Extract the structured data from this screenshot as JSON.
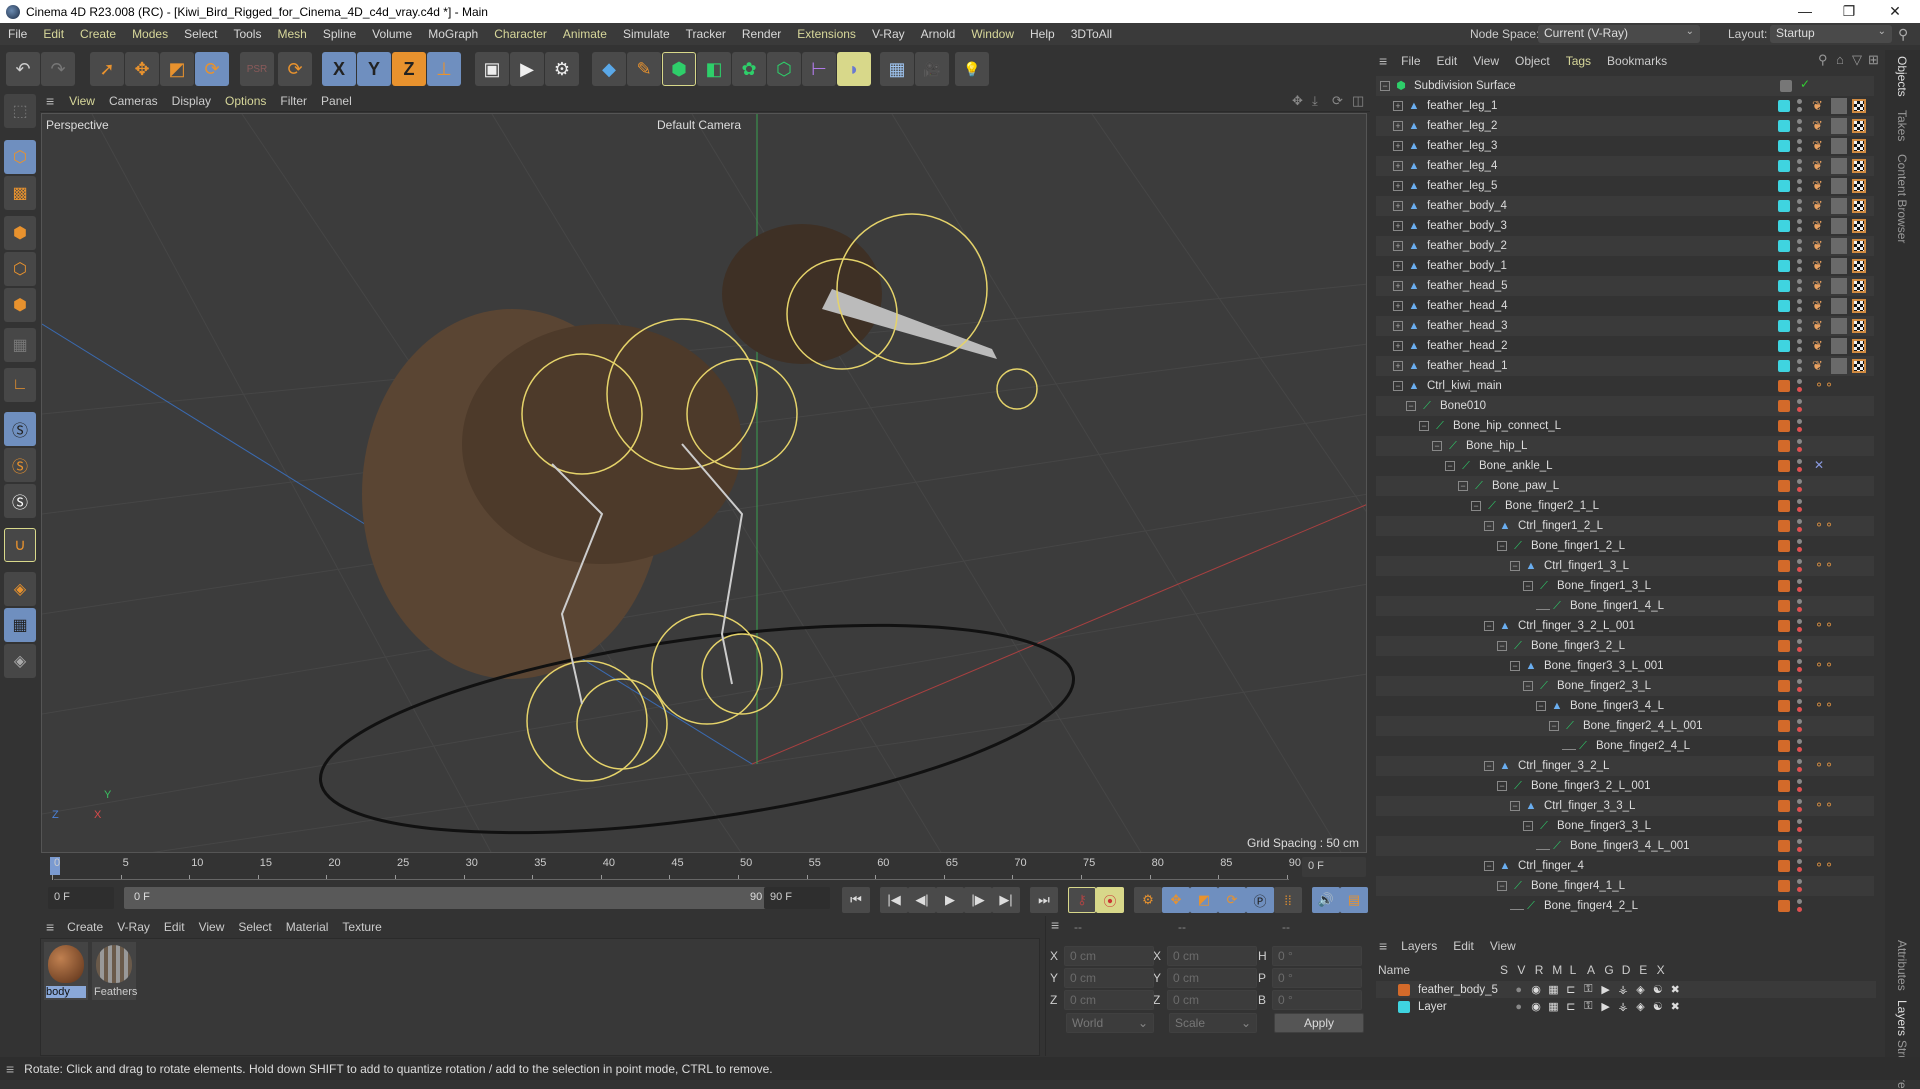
{
  "window": {
    "title": "Cinema 4D R23.008 (RC) - [Kiwi_Bird_Rigged_for_Cinema_4D_c4d_vray.c4d *] - Main",
    "minimize_icon": "—",
    "maximize_icon": "❐",
    "close_icon": "✕"
  },
  "menubar": {
    "items": [
      "File",
      "Edit",
      "Create",
      "Modes",
      "Select",
      "Tools",
      "Mesh",
      "Spline",
      "Volume",
      "MoGraph",
      "Character",
      "Animate",
      "Simulate",
      "Tracker",
      "Render",
      "Extensions",
      "V-Ray",
      "Arnold",
      "Window",
      "Help",
      "3DToAll"
    ],
    "node_space_label": "Node Space:",
    "node_space_value": "Current (V-Ray)",
    "layout_label": "Layout:",
    "layout_value": "Startup"
  },
  "toolbar": {
    "undo": "↶",
    "redo": "↷",
    "select": "➚",
    "move": "✥",
    "scale": "◩",
    "rotate": "⟳",
    "psr": "PSR",
    "recent": "⟳",
    "x_axis": "X",
    "y_axis": "Y",
    "z_axis": "Z",
    "coord_system": "⊥",
    "render_view": "▣",
    "render_pv": "▶",
    "render_settings": "⚙",
    "cube": "◆",
    "pen": "✎",
    "subdivision": "⬢",
    "extrude": "◧",
    "mograph_cloner": "✿",
    "array": "⬡",
    "deformer": "⊢",
    "field": "◗",
    "floor": "▦",
    "camera": "🎥",
    "light": "💡"
  },
  "left_tools": {
    "items": [
      "model-mode",
      "texture-mode",
      "points-mode",
      "edges-mode",
      "polygons-mode",
      "uv-mode",
      "axis-mode",
      "snap-s1",
      "snap-s2",
      "snap-s3",
      "magnet",
      "workplane",
      "workplane-lock",
      "workplane-rotate"
    ]
  },
  "viewport": {
    "menu": [
      "View",
      "Cameras",
      "Display",
      "Options",
      "Filter",
      "Panel"
    ],
    "label": "Perspective",
    "camera": "Default Camera",
    "grid_spacing": "Grid Spacing : 50 cm",
    "axis_x": "X",
    "axis_y": "Y",
    "axis_z": "Z"
  },
  "timeline": {
    "ticks": [
      "0",
      "5",
      "10",
      "15",
      "20",
      "25",
      "30",
      "35",
      "40",
      "45",
      "50",
      "55",
      "60",
      "65",
      "70",
      "75",
      "80",
      "85",
      "90"
    ],
    "current_frame": "0 F",
    "start_field": "0 F",
    "range_start": "0 F",
    "range_end": "90 F",
    "end_field": "90 F"
  },
  "transport": {
    "goto_start": "⏮",
    "prev_key": "|◀",
    "prev_frame": "◀|",
    "play": "▶",
    "next_frame": "|▶",
    "next_key": "▶|",
    "goto_end": "⏭"
  },
  "material_manager": {
    "menu": [
      "Create",
      "V-Ray",
      "Edit",
      "View",
      "Select",
      "Material",
      "Texture"
    ],
    "materials": [
      {
        "name": "body",
        "selected": true
      },
      {
        "name": "Feathers",
        "selected": false
      }
    ]
  },
  "coordinates": {
    "header": [
      "--",
      "--",
      "--"
    ],
    "rows": [
      {
        "l1": "X",
        "v1": "0 cm",
        "l2": "X",
        "v2": "0 cm",
        "l3": "H",
        "v3": "0 °"
      },
      {
        "l1": "Y",
        "v1": "0 cm",
        "l2": "Y",
        "v2": "0 cm",
        "l3": "P",
        "v3": "0 °"
      },
      {
        "l1": "Z",
        "v1": "0 cm",
        "l2": "Z",
        "v2": "0 cm",
        "l3": "B",
        "v3": "0 °"
      }
    ],
    "mode_dropdown": "World",
    "type_dropdown": "Scale",
    "apply_button": "Apply"
  },
  "object_manager": {
    "menu": [
      "File",
      "Edit",
      "View",
      "Object",
      "Tags",
      "Bookmarks"
    ],
    "root": "Subdivision Surface",
    "colors": {
      "cyan": "#3fd4e0",
      "orange": "#d36a2a"
    },
    "objects": [
      {
        "name": "feather_leg_1",
        "depth": 1,
        "type": "null",
        "color": "cyan",
        "expand": "+",
        "tags": true
      },
      {
        "name": "feather_leg_2",
        "depth": 1,
        "type": "null",
        "color": "cyan",
        "expand": "+",
        "tags": true
      },
      {
        "name": "feather_leg_3",
        "depth": 1,
        "type": "null",
        "color": "cyan",
        "expand": "+",
        "tags": true
      },
      {
        "name": "feather_leg_4",
        "depth": 1,
        "type": "null",
        "color": "cyan",
        "expand": "+",
        "tags": true
      },
      {
        "name": "feather_leg_5",
        "depth": 1,
        "type": "null",
        "color": "cyan",
        "expand": "+",
        "tags": true
      },
      {
        "name": "feather_body_4",
        "depth": 1,
        "type": "null",
        "color": "cyan",
        "expand": "+",
        "tags": true
      },
      {
        "name": "feather_body_3",
        "depth": 1,
        "type": "null",
        "color": "cyan",
        "expand": "+",
        "tags": true
      },
      {
        "name": "feather_body_2",
        "depth": 1,
        "type": "null",
        "color": "cyan",
        "expand": "+",
        "tags": true
      },
      {
        "name": "feather_body_1",
        "depth": 1,
        "type": "null",
        "color": "cyan",
        "expand": "+",
        "tags": true
      },
      {
        "name": "feather_head_5",
        "depth": 1,
        "type": "null",
        "color": "cyan",
        "expand": "+",
        "tags": true
      },
      {
        "name": "feather_head_4",
        "depth": 1,
        "type": "null",
        "color": "cyan",
        "expand": "+",
        "tags": true
      },
      {
        "name": "feather_head_3",
        "depth": 1,
        "type": "null",
        "color": "cyan",
        "expand": "+",
        "tags": true
      },
      {
        "name": "feather_head_2",
        "depth": 1,
        "type": "null",
        "color": "cyan",
        "expand": "+",
        "tags": true
      },
      {
        "name": "feather_head_1",
        "depth": 1,
        "type": "null",
        "color": "cyan",
        "expand": "+",
        "tags": true
      },
      {
        "name": "Ctrl_kiwi_main",
        "depth": 1,
        "type": "null",
        "color": "orange",
        "expand": "-",
        "constraint": true
      },
      {
        "name": "Bone010",
        "depth": 2,
        "type": "bone",
        "color": "orange",
        "expand": "-"
      },
      {
        "name": "Bone_hip_connect_L",
        "depth": 3,
        "type": "bone",
        "color": "orange",
        "expand": "-"
      },
      {
        "name": "Bone_hip_L",
        "depth": 4,
        "type": "bone",
        "color": "orange",
        "expand": "-"
      },
      {
        "name": "Bone_ankle_L",
        "depth": 5,
        "type": "bone",
        "color": "orange",
        "expand": "-",
        "ik": true
      },
      {
        "name": "Bone_paw_L",
        "depth": 6,
        "type": "bone",
        "color": "orange",
        "expand": "-"
      },
      {
        "name": "Bone_finger2_1_L",
        "depth": 7,
        "type": "bone",
        "color": "orange",
        "expand": "-"
      },
      {
        "name": "Ctrl_finger1_2_L",
        "depth": 8,
        "type": "null",
        "color": "orange",
        "expand": "-",
        "constraint": true
      },
      {
        "name": "Bone_finger1_2_L",
        "depth": 9,
        "type": "bone",
        "color": "orange",
        "expand": "-"
      },
      {
        "name": "Ctrl_finger1_3_L",
        "depth": 10,
        "type": "null",
        "color": "orange",
        "expand": "-",
        "constraint": true
      },
      {
        "name": "Bone_finger1_3_L",
        "depth": 11,
        "type": "bone",
        "color": "orange",
        "expand": "-"
      },
      {
        "name": "Bone_finger1_4_L",
        "depth": 12,
        "type": "bone",
        "color": "orange",
        "expand": ""
      },
      {
        "name": "Ctrl_finger_3_2_L_001",
        "depth": 8,
        "type": "null",
        "color": "orange",
        "expand": "-",
        "constraint": true
      },
      {
        "name": "Bone_finger3_2_L",
        "depth": 9,
        "type": "bone",
        "color": "orange",
        "expand": "-"
      },
      {
        "name": "Bone_finger3_3_L_001",
        "depth": 10,
        "type": "null",
        "color": "orange",
        "expand": "-",
        "constraint": true
      },
      {
        "name": "Bone_finger2_3_L",
        "depth": 11,
        "type": "bone",
        "color": "orange",
        "expand": "-"
      },
      {
        "name": "Bone_finger3_4_L",
        "depth": 12,
        "type": "null",
        "color": "orange",
        "expand": "-",
        "constraint": true
      },
      {
        "name": "Bone_finger2_4_L_001",
        "depth": 13,
        "type": "bone",
        "color": "orange",
        "expand": "-"
      },
      {
        "name": "Bone_finger2_4_L",
        "depth": 14,
        "type": "bone",
        "color": "orange",
        "expand": ""
      },
      {
        "name": "Ctrl_finger_3_2_L",
        "depth": 8,
        "type": "null",
        "color": "orange",
        "expand": "-",
        "constraint": true
      },
      {
        "name": "Bone_finger3_2_L_001",
        "depth": 9,
        "type": "bone",
        "color": "orange",
        "expand": "-"
      },
      {
        "name": "Ctrl_finger_3_3_L",
        "depth": 10,
        "type": "null",
        "color": "orange",
        "expand": "-",
        "constraint": true
      },
      {
        "name": "Bone_finger3_3_L",
        "depth": 11,
        "type": "bone",
        "color": "orange",
        "expand": "-"
      },
      {
        "name": "Bone_finger3_4_L_001",
        "depth": 12,
        "type": "bone",
        "color": "orange",
        "expand": ""
      },
      {
        "name": "Ctrl_finger_4",
        "depth": 8,
        "type": "null",
        "color": "orange",
        "expand": "-",
        "constraint": true
      },
      {
        "name": "Bone_finger4_1_L",
        "depth": 9,
        "type": "bone",
        "color": "orange",
        "expand": "-"
      },
      {
        "name": "Bone_finger4_2_L",
        "depth": 10,
        "type": "bone",
        "color": "orange",
        "expand": ""
      }
    ]
  },
  "side_tabs": [
    "Objects",
    "Takes",
    "Content Browser",
    "Attributes",
    "Layers",
    "Structure"
  ],
  "layer_manager": {
    "menu": [
      "Layers",
      "Edit",
      "View"
    ],
    "columns": [
      "Name",
      "S",
      "V",
      "R",
      "M",
      "L",
      "A",
      "G",
      "D",
      "E",
      "X"
    ],
    "layers": [
      {
        "name": "feather_body_5",
        "color": "#d36a2a"
      },
      {
        "name": "Layer",
        "color": "#3fd4e0"
      }
    ]
  },
  "statusbar": {
    "text": "Rotate: Click and drag to rotate elements. Hold down SHIFT to add to quantize rotation / add to the selection in point mode, CTRL to remove."
  }
}
